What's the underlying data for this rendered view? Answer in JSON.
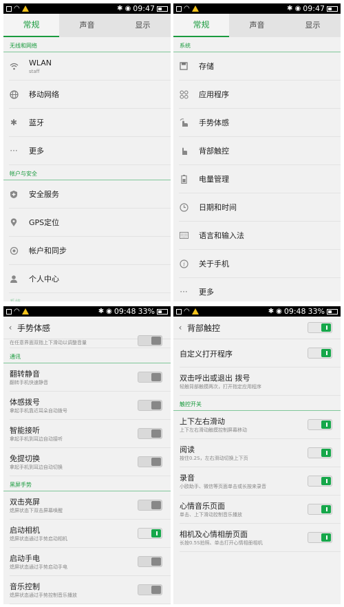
{
  "status": {
    "time_a": "09:47",
    "time_b": "09:48",
    "battery_text": "33%"
  },
  "tabs": [
    "常规",
    "声音",
    "显示"
  ],
  "panel1": {
    "sections": [
      {
        "title": "无线和网络",
        "items": [
          {
            "label": "WLAN",
            "sub": "staff",
            "icon": "wifi-icon"
          },
          {
            "label": "移动网络",
            "icon": "globe-icon"
          },
          {
            "label": "蓝牙",
            "icon": "bluetooth-icon"
          },
          {
            "label": "更多",
            "icon": "more-icon"
          }
        ]
      },
      {
        "title": "帐户与安全",
        "items": [
          {
            "label": "安全服务",
            "icon": "shield-icon"
          },
          {
            "label": "GPS定位",
            "icon": "location-icon"
          },
          {
            "label": "帐户和同步",
            "icon": "sync-icon"
          },
          {
            "label": "个人中心",
            "icon": "person-icon"
          }
        ]
      }
    ],
    "cut_section": "系统"
  },
  "panel2": {
    "section": "系统",
    "items": [
      {
        "label": "存储",
        "icon": "storage-icon"
      },
      {
        "label": "应用程序",
        "icon": "apps-icon"
      },
      {
        "label": "手势体感",
        "icon": "gesture-icon"
      },
      {
        "label": "背部触控",
        "icon": "touch-icon"
      },
      {
        "label": "电量管理",
        "icon": "battery-icon"
      },
      {
        "label": "日期和时间",
        "icon": "clock-icon"
      },
      {
        "label": "语言和输入法",
        "icon": "keyboard-icon"
      },
      {
        "label": "关于手机",
        "icon": "info-icon"
      },
      {
        "label": "更多",
        "icon": "more-icon"
      }
    ]
  },
  "panel3": {
    "title": "手势体感",
    "cut_text": "在任意界面双指上下滑动以调整音量",
    "sections": [
      {
        "title": "通讯",
        "items": [
          {
            "label": "翻转静音",
            "sub": "翻转手机快速静音",
            "on": false
          },
          {
            "label": "体感拨号",
            "sub": "拿起手机靠近耳朵自动拨号",
            "on": false
          },
          {
            "label": "智能接听",
            "sub": "拿起手机到耳边自动接听",
            "on": false
          },
          {
            "label": "免提切换",
            "sub": "拿起手机到耳边自动切换",
            "on": false
          }
        ]
      },
      {
        "title": "黑屏手势",
        "items": [
          {
            "label": "双击亮屏",
            "sub": "熄屏状态下双击屏幕唤醒",
            "on": false
          },
          {
            "label": "启动相机",
            "sub": "熄屏状态通过手势启动相机",
            "on": true
          },
          {
            "label": "启动手电",
            "sub": "熄屏状态通过手势启动手电",
            "on": false
          },
          {
            "label": "音乐控制",
            "sub": "熄屏状态通过手势控制音乐播放",
            "on": false
          }
        ]
      }
    ]
  },
  "panel4": {
    "title": "背部触控",
    "header_toggle_on": true,
    "top_items": [
      {
        "label": "自定义打开程序",
        "on": true
      },
      {
        "label": "双击呼出或退出 拨号",
        "sub": "轻触背部触摸两次，打开指定应用程序"
      }
    ],
    "section": "触控开关",
    "items": [
      {
        "label": "上下左右滑动",
        "sub": "上下左右滑动触摸控制屏幕移动",
        "on": true
      },
      {
        "label": "阅读",
        "sub": "按住0.2S，左右滑动切换上下页",
        "on": true
      },
      {
        "label": "录音",
        "sub": "小欧助手、微信等页面单击或长按来录音",
        "on": true
      },
      {
        "label": "心情音乐页面",
        "sub": "单击、上下滑动控制音乐播放",
        "on": true
      },
      {
        "label": "相机及心情相册页面",
        "sub": "长按0.5S拍照、单击打开心情相册相机",
        "on": true
      }
    ]
  }
}
